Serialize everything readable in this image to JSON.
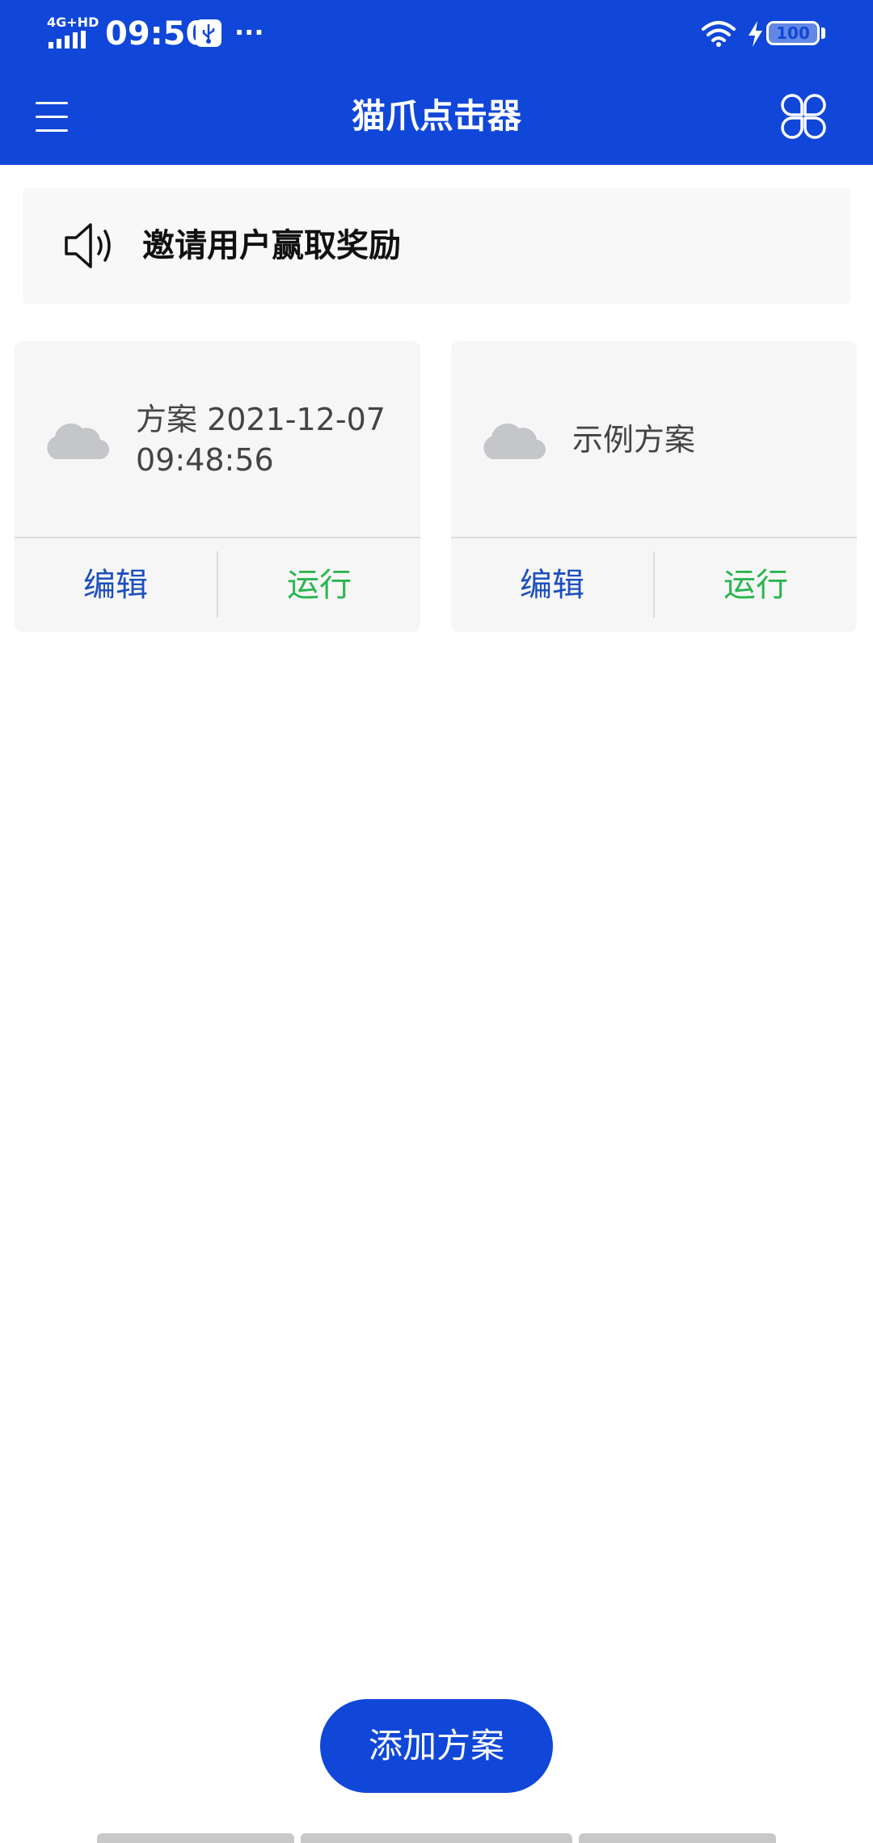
{
  "status_bar": {
    "network": "4G+HD",
    "time": "09:50",
    "more": "···",
    "battery": "100"
  },
  "app_bar": {
    "title": "猫爪点击器"
  },
  "banner": {
    "text": "邀请用户赢取奖励"
  },
  "cards": [
    {
      "title": "方案 2021-12-07 09:48:56",
      "edit_label": "编辑",
      "run_label": "运行"
    },
    {
      "title": "示例方案",
      "edit_label": "编辑",
      "run_label": "运行"
    }
  ],
  "footer": {
    "add_button": "添加方案"
  },
  "colors": {
    "primary": "#1047d8",
    "edit": "#1c4fbd",
    "run": "#2bb54f",
    "card_background": "#f6f6f6",
    "cloud": "#c4c6c9"
  },
  "icons": {
    "menu": "menu-icon",
    "apps": "apps-icon",
    "speaker": "speaker-icon",
    "cloud": "cloud-icon",
    "wifi": "wifi-icon",
    "charging": "charging-icon",
    "usb": "usb-icon"
  }
}
